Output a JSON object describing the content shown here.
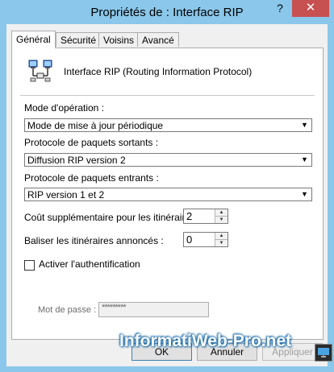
{
  "window": {
    "title": "Propriétés de : Interface RIP",
    "help_glyph": "?",
    "close_glyph": "✕",
    "close_color": "#c75050",
    "frame_color": "#8ac7ea"
  },
  "tabs": [
    {
      "label": "Général",
      "active": true
    },
    {
      "label": "Sécurité",
      "active": false
    },
    {
      "label": "Voisins",
      "active": false
    },
    {
      "label": "Avancé",
      "active": false
    }
  ],
  "header": {
    "icon": "network-interface-icon",
    "text": "Interface RIP (Routing Information Protocol)"
  },
  "mode": {
    "label": "Mode d'opération :",
    "value": "Mode de mise à jour périodique"
  },
  "outgoing": {
    "label": "Protocole de paquets sortants :",
    "value": "Diffusion RIP version 2"
  },
  "incoming": {
    "label": "Protocole de paquets entrants :",
    "value": "RIP version 1 et 2"
  },
  "cost": {
    "label": "Coût supplémentaire pour les itinéraires :",
    "value": "2"
  },
  "tag": {
    "label": "Baliser les itinéraires annoncés :",
    "value": "0"
  },
  "auth": {
    "label": "Activer l'authentification",
    "checked": false,
    "password_label": "Mot de passe :",
    "password_value": "*********"
  },
  "buttons": {
    "ok": "OK",
    "cancel": "Annuler",
    "apply": "Appliquer"
  },
  "watermark": {
    "text": "InformatiWeb-Pro.net"
  }
}
